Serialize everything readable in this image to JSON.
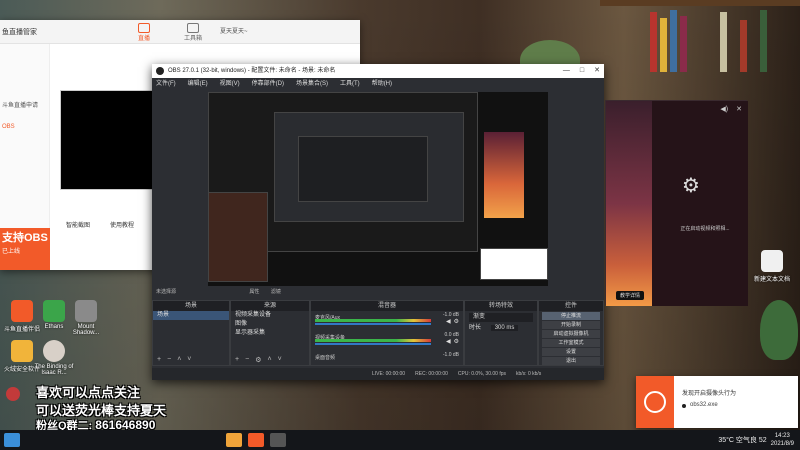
{
  "helper_app": {
    "title": "鱼直播管家",
    "nav_live": "直播",
    "nav_tools": "工具箱",
    "side_live_label": "斗鱼直播申请",
    "side_obs_label": "OBS",
    "user": "夏天夏天~",
    "support_big": "支持OBS",
    "support_small": "已上线",
    "tile_btn_1": "智能截图",
    "tile_btn_2": "使用教程"
  },
  "obs": {
    "title": "OBS 27.0.1 (32-bit, windows) - 配置文件: 未命名 - 场景: 未命名",
    "menu": [
      "文件(F)",
      "编辑(E)",
      "视图(V)",
      "停靠部件(D)",
      "场景集合(S)",
      "工具(T)",
      "帮助(H)"
    ],
    "win_buttons": [
      "—",
      "□",
      "✕"
    ],
    "no_source_selected": "未选择源",
    "properties_btn": "属性",
    "filters_btn": "滤镜",
    "scenes_title": "场景",
    "scenes": [
      "场景"
    ],
    "sources_title": "来源",
    "sources": [
      "视频采集设备",
      "图像",
      "显示器采集"
    ],
    "mixer_title": "混音器",
    "mixer": [
      {
        "name": "麦克风/Aux",
        "db": "-1.0 dB"
      },
      {
        "name": "视频采集设备",
        "db": "0.0 dB"
      },
      {
        "name": "桌面音频",
        "db": "-1.0 dB"
      }
    ],
    "transitions_title": "转场特效",
    "transition_value": "渐变",
    "duration_label": "时长",
    "duration_value": "300 ms",
    "controls_title": "控件",
    "controls": [
      "停止推流",
      "开始录制",
      "启动虚拟摄像机",
      "工作室模式",
      "设置",
      "退出"
    ],
    "status_live": "LIVE: 00:00:00",
    "status_rec": "REC: 00:00:00",
    "status_cpu": "CPU: 0.0%, 30.00 fps",
    "status_kb": "kb/s: 0 kb/s"
  },
  "camera_app": {
    "message": "正在启动视频和照相...",
    "pill": "教学详情",
    "top_controls": [
      "◀)",
      "✕"
    ]
  },
  "toast": {
    "text": "发现开启摄像头行为",
    "file": "obs32.exe"
  },
  "overlay": {
    "line1": "喜欢可以点点关注",
    "line2": "可以送荧光棒支持夏天",
    "line3_label": "粉丝Q群二:",
    "line3_value": "861646890"
  },
  "desktop_icons": [
    {
      "label": "斗鱼直播伴侣"
    },
    {
      "label": "Ethans"
    },
    {
      "label": "Mount Shadow..."
    },
    {
      "label": "火绒安全软件"
    },
    {
      "label": "The Binding of Isaac R..."
    },
    {
      "label": "新建文本文档"
    }
  ],
  "tray": {
    "weather": "35°C 空气良 52",
    "time": "14:23",
    "date": "2021/8/9"
  }
}
